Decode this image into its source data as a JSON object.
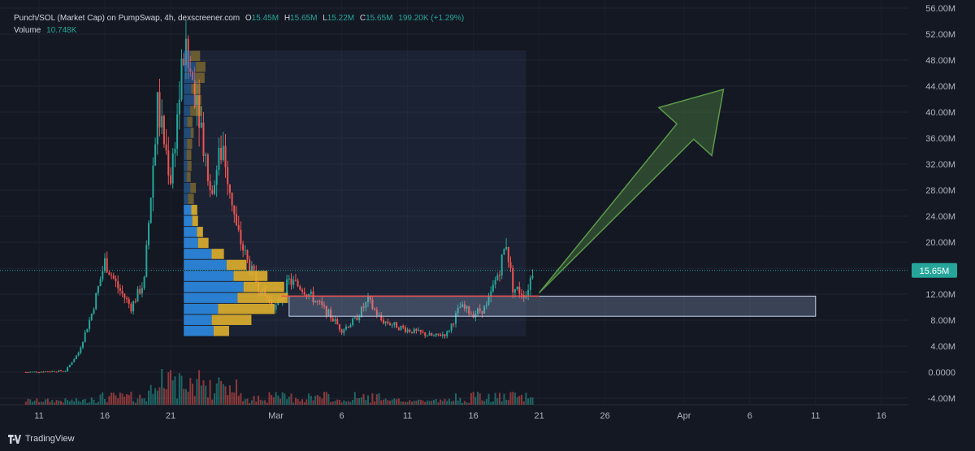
{
  "legend": {
    "title": "Punch/SOL (Market Cap) on PumpSwap, 4h, dexscreener.com",
    "o_label": "O",
    "o_value": "15.45M",
    "h_label": "H",
    "h_value": "15.65M",
    "l_label": "L",
    "l_value": "15.22M",
    "c_label": "C",
    "c_value": "15.65M",
    "change": "199.20K (+1.29%)",
    "volume_label": "Volume",
    "volume_value": "10.748K"
  },
  "brand": "TradingView",
  "colors": {
    "background": "#141823",
    "up": "#26a69a",
    "down": "#ef5350",
    "profile_blue": "#2a7fd0",
    "profile_yellow": "#e0b02e",
    "arrow": "#4a7f3f",
    "zone": "#9fb4d8"
  },
  "chart_data": {
    "type": "candlestick",
    "title": "Punch/SOL (Market Cap) on PumpSwap, 4h",
    "y_unit": "M",
    "ylim": [
      -4,
      56
    ],
    "y_ticks": [
      "56.00M",
      "52.00M",
      "48.00M",
      "44.00M",
      "40.00M",
      "36.00M",
      "32.00M",
      "28.00M",
      "24.00M",
      "20.00M",
      "16.00M",
      "12.00M",
      "8.00M",
      "4.00M",
      "0.0000",
      "-4.00M"
    ],
    "x_ticks": [
      "11",
      "16",
      "21",
      "Mar",
      "6",
      "11",
      "16",
      "21",
      "26",
      "Apr",
      "6",
      "11",
      "16"
    ],
    "last_price": 15.65,
    "last_price_label": "15.65M",
    "price_path": [
      {
        "t": "Feb 10",
        "v": 0
      },
      {
        "t": "Feb 13",
        "v": 0.2
      },
      {
        "t": "Feb 14",
        "v": 3
      },
      {
        "t": "Feb 15",
        "v": 9
      },
      {
        "t": "Feb 16",
        "v": 17
      },
      {
        "t": "Feb 17",
        "v": 13
      },
      {
        "t": "Feb 18",
        "v": 10
      },
      {
        "t": "Feb 19",
        "v": 14
      },
      {
        "t": "Feb 20",
        "v": 41
      },
      {
        "t": "Feb 21",
        "v": 30
      },
      {
        "t": "Feb 22",
        "v": 49
      },
      {
        "t": "Feb 23",
        "v": 43
      },
      {
        "t": "Feb 24",
        "v": 28
      },
      {
        "t": "Feb 25",
        "v": 35
      },
      {
        "t": "Feb 26",
        "v": 22
      },
      {
        "t": "Feb 27",
        "v": 16
      },
      {
        "t": "Feb 28",
        "v": 12
      },
      {
        "t": "Mar 1",
        "v": 10
      },
      {
        "t": "Mar 2",
        "v": 14
      },
      {
        "t": "Mar 3",
        "v": 13
      },
      {
        "t": "Mar 5",
        "v": 9
      },
      {
        "t": "Mar 6",
        "v": 6.5
      },
      {
        "t": "Mar 7",
        "v": 8
      },
      {
        "t": "Mar 8",
        "v": 11
      },
      {
        "t": "Mar 9",
        "v": 8
      },
      {
        "t": "Mar 11",
        "v": 6.5
      },
      {
        "t": "Mar 13",
        "v": 5.5
      },
      {
        "t": "Mar 14",
        "v": 6
      },
      {
        "t": "Mar 15",
        "v": 10
      },
      {
        "t": "Mar 16",
        "v": 9
      },
      {
        "t": "Mar 17",
        "v": 10
      },
      {
        "t": "Mar 18",
        "v": 16
      },
      {
        "t": "Mar 18.5",
        "v": 20
      },
      {
        "t": "Mar 19",
        "v": 13
      },
      {
        "t": "Mar 20",
        "v": 12
      },
      {
        "t": "Mar 20.5",
        "v": 15.65
      }
    ],
    "support_level": 11.7,
    "demand_zone": {
      "low": 8.6,
      "high": 11.7,
      "from": "Mar 2",
      "to": "Apr 11"
    },
    "volume_profile_range": {
      "from": "Feb 22",
      "to": "Mar 20",
      "low": 5.5,
      "high": 49.5
    },
    "projection_arrow": {
      "from_date": "Mar 21",
      "from": 12.2,
      "to_date": "Apr 4",
      "to": 43.5
    }
  }
}
